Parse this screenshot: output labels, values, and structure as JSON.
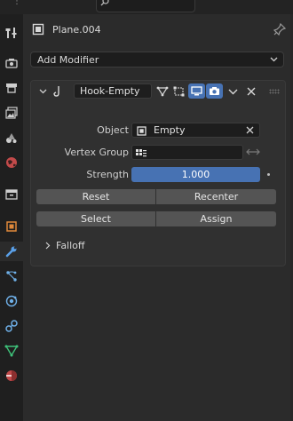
{
  "header": {
    "object_name": "Plane.004"
  },
  "add_modifier": {
    "label": "Add Modifier"
  },
  "modifier": {
    "name": "Hook-Empty",
    "object_label": "Object",
    "object_value": "Empty",
    "vertex_group_label": "Vertex Group",
    "vertex_group_value": "",
    "strength_label": "Strength",
    "strength_value": "1.000",
    "reset_label": "Reset",
    "recenter_label": "Recenter",
    "select_label": "Select",
    "assign_label": "Assign",
    "falloff_label": "Falloff"
  },
  "tabs": [
    {
      "icon": "tool-icon"
    },
    {
      "icon": "render-icon"
    },
    {
      "icon": "output-icon"
    },
    {
      "icon": "view-layer-icon"
    },
    {
      "icon": "scene-icon"
    },
    {
      "icon": "world-icon"
    },
    {
      "icon": "collection-icon"
    },
    {
      "icon": "object-icon"
    },
    {
      "icon": "modifier-wrench-icon",
      "active": true
    },
    {
      "icon": "particles-icon"
    },
    {
      "icon": "physics-icon"
    },
    {
      "icon": "constraints-icon"
    },
    {
      "icon": "object-data-icon"
    },
    {
      "icon": "material-icon"
    }
  ],
  "colors": {
    "accent": "#4772b3",
    "panel_bg": "#2b2b2b",
    "tabbar_bg": "#1f1f1f",
    "button_bg": "#545454",
    "field_bg": "#1d1d1d"
  }
}
